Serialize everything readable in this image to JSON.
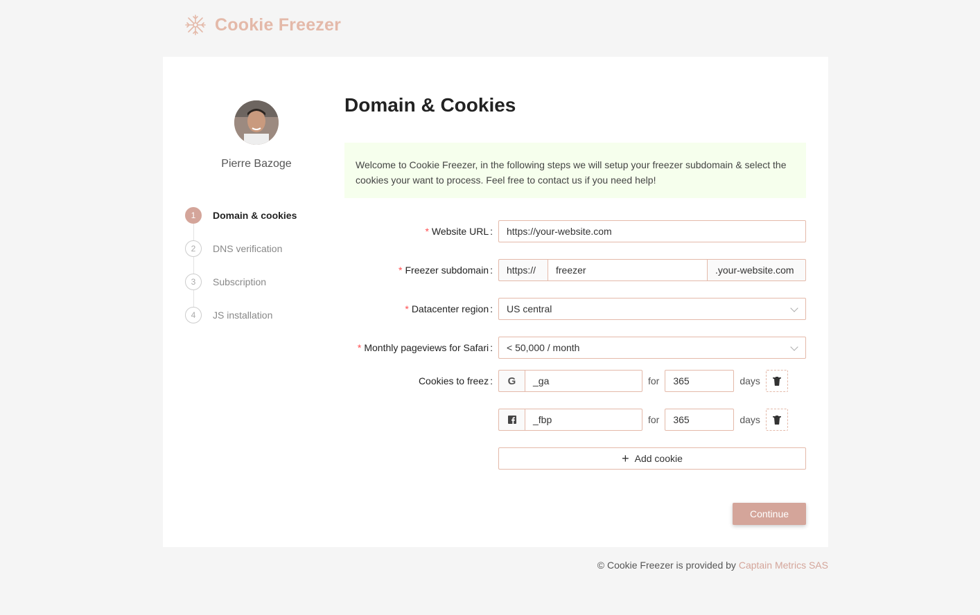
{
  "header": {
    "app_name": "Cookie Freezer",
    "logo_icon": "snowflake-icon"
  },
  "user": {
    "name": "Pierre Bazoge",
    "avatar_icon": "user-avatar"
  },
  "steps": [
    {
      "number": "1",
      "label": "Domain & cookies",
      "active": true
    },
    {
      "number": "2",
      "label": "DNS verification",
      "active": false
    },
    {
      "number": "3",
      "label": "Subscription",
      "active": false
    },
    {
      "number": "4",
      "label": "JS installation",
      "active": false
    }
  ],
  "main": {
    "title": "Domain & Cookies",
    "info": "Welcome to Cookie Freezer, in the following steps we will setup your freezer subdomain & select the cookies your want to process. Feel free to contact us if you need help!"
  },
  "form": {
    "website_url": {
      "label": "Website URL",
      "value": "https://your-website.com",
      "required": true
    },
    "subdomain": {
      "label": "Freezer subdomain",
      "prefix": "https://",
      "value": "freezer",
      "suffix": ".your-website.com",
      "required": true
    },
    "region": {
      "label": "Datacenter region",
      "value": "US central",
      "required": true
    },
    "pageviews": {
      "label": "Monthly pageviews for Safari",
      "value": "< 50,000 / month",
      "required": true
    },
    "cookies": {
      "label": "Cookies to freez",
      "for_text": "for",
      "days_text": "days",
      "items": [
        {
          "icon": "google-icon",
          "icon_glyph": "G",
          "name": "_ga",
          "days": "365"
        },
        {
          "icon": "facebook-icon",
          "icon_glyph": "f",
          "name": "_fbp",
          "days": "365"
        }
      ],
      "add_label": "Add cookie"
    },
    "continue_label": "Continue"
  },
  "footer": {
    "text": "© Cookie Freezer is provided by",
    "link": "Captain Metrics SAS"
  },
  "colors": {
    "accent": "#d4a59a",
    "logo": "#e4b9a9",
    "info_bg": "#f6ffed"
  }
}
